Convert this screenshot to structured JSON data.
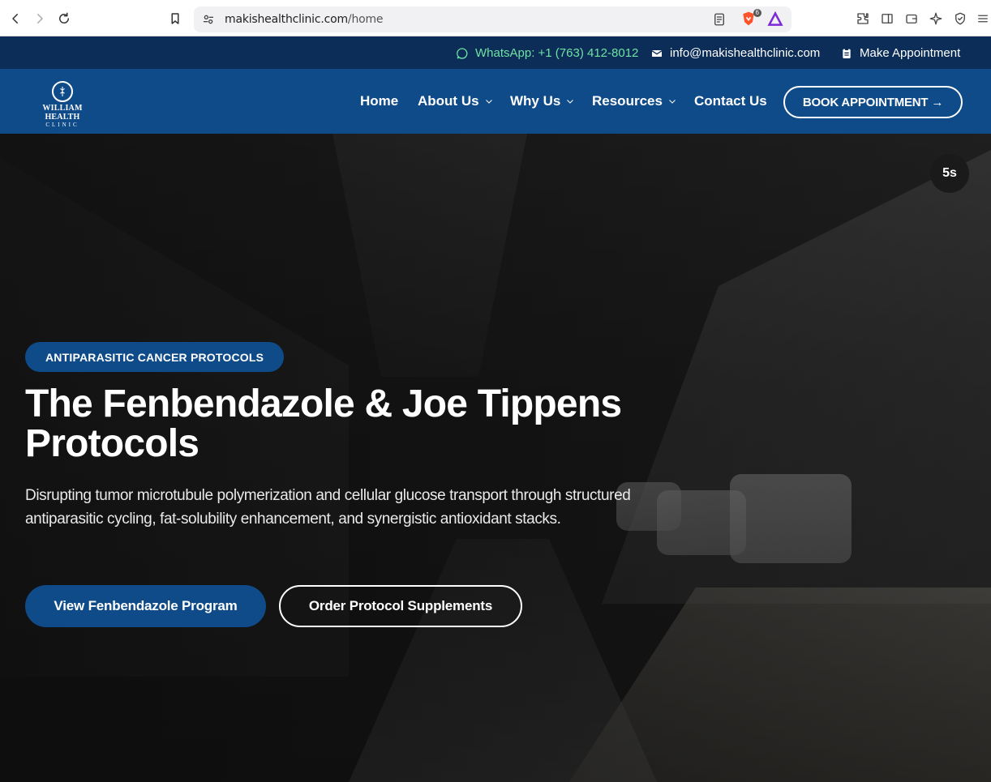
{
  "browser": {
    "url_domain": "makishealthclinic.com",
    "url_path": "/home",
    "brave_badge": "6"
  },
  "topbar": {
    "whatsapp": "WhatsApp: +1 (763) 412-8012",
    "email": "info@makishealthclinic.com",
    "appointment": "Make Appointment"
  },
  "logo": {
    "name": "WILLIAM HEALTH",
    "sub": "CLINIC"
  },
  "nav": {
    "home": "Home",
    "about": "About Us",
    "why": "Why Us",
    "resources": "Resources",
    "contact": "Contact Us",
    "book": "BOOK APPOINTMENT →"
  },
  "hero": {
    "timer": "5s",
    "badge": "ANTIPARASITIC CANCER PROTOCOLS",
    "title": "The Fenbendazole & Joe Tippens Protocols",
    "description": "Disrupting tumor microtubule polymerization and cellular glucose transport through structured antiparasitic cycling, fat-solubility enhancement, and synergistic antioxidant stacks.",
    "primary_button": "View Fenbendazole Program",
    "secondary_button": "Order Protocol Supplements"
  },
  "colors": {
    "topbar_bg": "#0b2d57",
    "header_bg": "#0f4b88",
    "whatsapp_green": "#6fe3a3",
    "accent_blue": "#0f4b88"
  }
}
